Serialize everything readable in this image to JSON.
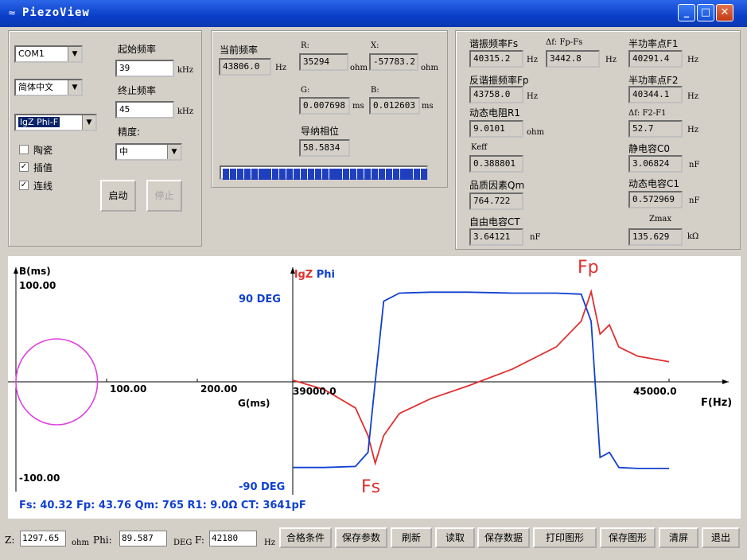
{
  "window": {
    "title": "PiezoView"
  },
  "left_panel": {
    "port": "COM1",
    "language": "简体中文",
    "mode": "lgZ Phi-F",
    "start_freq_label": "起始频率",
    "start_freq": "39",
    "stop_freq_label": "终止频率",
    "stop_freq": "45",
    "freq_unit": "kHz",
    "precision_label": "精度:",
    "precision": "中",
    "ceramic_label": "陶瓷",
    "ceramic_checked": false,
    "interp_label": "插值",
    "interp_checked": true,
    "connect_label": "连线",
    "connect_checked": true,
    "start_button": "启动",
    "stop_button": "停止"
  },
  "middle_panel": {
    "cur_freq_label": "当前频率",
    "cur_freq": "43806.0",
    "cur_freq_unit": "Hz",
    "r_label": "R:",
    "r_value": "35294",
    "r_unit": "ohm",
    "x_label": "X:",
    "x_value": "-57783.2",
    "x_unit": "ohm",
    "g_label": "G:",
    "g_value": "0.007698",
    "g_unit": "ms",
    "b_label": "B:",
    "b_value": "0.012603",
    "b_unit": "ms",
    "phase_label": "导纳相位",
    "phase_value": "58.5834",
    "progress": 1.0
  },
  "right_panel": {
    "fs_label": "谐振频率Fs",
    "fs_value": "40315.2",
    "fs_unit": "Hz",
    "dfp_label": "Δf: Fp-Fs",
    "dfp_value": "3442.8",
    "dfp_unit": "Hz",
    "f1_label": "半功率点F1",
    "f1_value": "40291.4",
    "f1_unit": "Hz",
    "fp_label": "反谐振频率Fp",
    "fp_value": "43758.0",
    "fp_unit": "Hz",
    "f2_label": "半功率点F2",
    "f2_value": "40344.1",
    "f2_unit": "Hz",
    "r1_label": "动态电阻R1",
    "r1_value": "9.0101",
    "r1_unit": "ohm",
    "df2_label": "Δf: F2-F1",
    "df2_value": "52.7",
    "df2_unit": "Hz",
    "keff_label": "Keff",
    "keff_value": "0.388801",
    "c0_label": "静电容C0",
    "c0_value": "3.06824",
    "c0_unit": "nF",
    "qm_label": "品质因素Qm",
    "qm_value": "764.722",
    "c1_label": "动态电容C1",
    "c1_value": "0.572969",
    "c1_unit": "nF",
    "ct_label": "自由电容CT",
    "ct_value": "3.64121",
    "ct_unit": "nF",
    "zmax_label": "Zmax",
    "zmax_value": "135.629",
    "zmax_unit": "kΩ"
  },
  "admittance_plot": {
    "b_axis_label": "B(ms)",
    "g_axis_label": "G(ms)",
    "y_top": "100.00",
    "y_bottom": "-100.00",
    "x_tick1": "100.00",
    "x_tick2": "200.00",
    "circle_color": "#e040e0"
  },
  "freq_plot": {
    "legend_lgz": "lgZ",
    "legend_phi": "Phi",
    "phase_top": "90 DEG",
    "phase_bottom": "-90 DEG",
    "x_start": "39000.0",
    "x_end": "45000.0",
    "x_axis_label": "F(Hz)",
    "fs_marker": "Fs",
    "fp_marker": "Fp",
    "lgz_color": "#e03030",
    "phi_color": "#1040d0"
  },
  "summary_line": "Fs: 40.32  Fp: 43.76  Qm: 765  R1: 9.0Ω  CT: 3641pF",
  "chart_data": [
    {
      "type": "scatter",
      "title": "",
      "xlabel": "G(ms)",
      "ylabel": "B(ms)",
      "xlim": [
        0,
        200
      ],
      "ylim": [
        -100,
        100
      ],
      "series": [
        {
          "name": "",
          "shape": "circle",
          "center": [
            45,
            0
          ],
          "radius": 45
        }
      ]
    },
    {
      "type": "line",
      "title": "",
      "xlabel": "F(Hz)",
      "ylabel": "lgZ Phi",
      "xlim": [
        39000,
        45000
      ],
      "x": [
        39000,
        39500,
        40000,
        40200,
        40315,
        40450,
        40700,
        41200,
        41800,
        42500,
        43200,
        43600,
        43758,
        43900,
        44050,
        44200,
        44500,
        45000
      ],
      "series": [
        {
          "name": "lgZ",
          "values": [
            0.5,
            0.45,
            0.35,
            0.2,
            0.05,
            0.2,
            0.32,
            0.4,
            0.47,
            0.56,
            0.68,
            0.82,
            0.98,
            0.75,
            0.8,
            0.68,
            0.63,
            0.6
          ]
        },
        {
          "name": "Phi",
          "values": [
            -85,
            -85,
            -84,
            -70,
            0,
            80,
            88,
            89,
            89,
            88,
            88,
            87,
            60,
            -75,
            -70,
            -85,
            -86,
            -86
          ]
        }
      ]
    }
  ],
  "status_bar": {
    "z_label": "Z:",
    "z_value": "1297.65",
    "z_unit": "ohm",
    "phi_label": "Phi:",
    "phi_value": "89.587",
    "phi_unit": "DEG",
    "f_label": "F:",
    "f_value": "42180",
    "f_unit": "Hz",
    "buttons": [
      "合格条件",
      "保存参数",
      "刷新",
      "读取",
      "保存数据",
      "打印图形",
      "保存图形",
      "清屏",
      "退出"
    ]
  }
}
